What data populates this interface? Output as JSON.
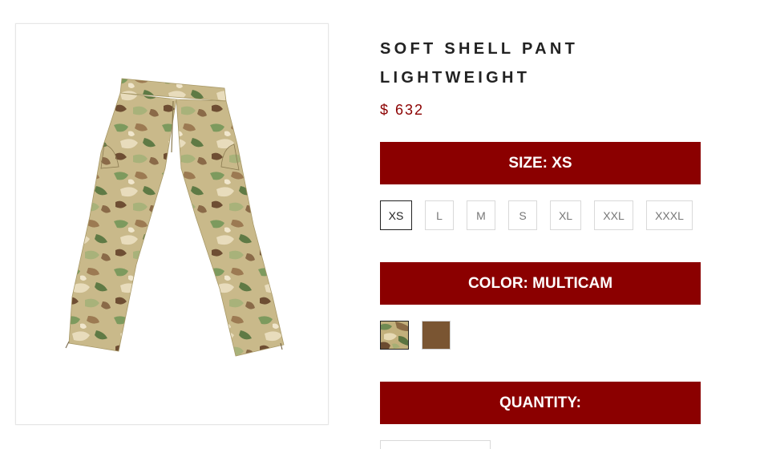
{
  "product": {
    "title_line1": "SOFT SHELL PANT",
    "title_line2": "LIGHTWEIGHT",
    "price": "$ 632"
  },
  "size": {
    "label": "SIZE:",
    "selected": "XS",
    "options": [
      "XS",
      "L",
      "M",
      "S",
      "XL",
      "XXL",
      "XXXL"
    ]
  },
  "color": {
    "label": "COLOR:",
    "selected": "MULTICAM",
    "swatches": [
      {
        "name": "multicam",
        "hex": "#b8a874"
      },
      {
        "name": "coyote",
        "hex": "#7a5532"
      }
    ]
  },
  "quantity": {
    "label": "QUANTITY:"
  },
  "colors": {
    "accent": "#8b0000",
    "title": "#222222"
  }
}
